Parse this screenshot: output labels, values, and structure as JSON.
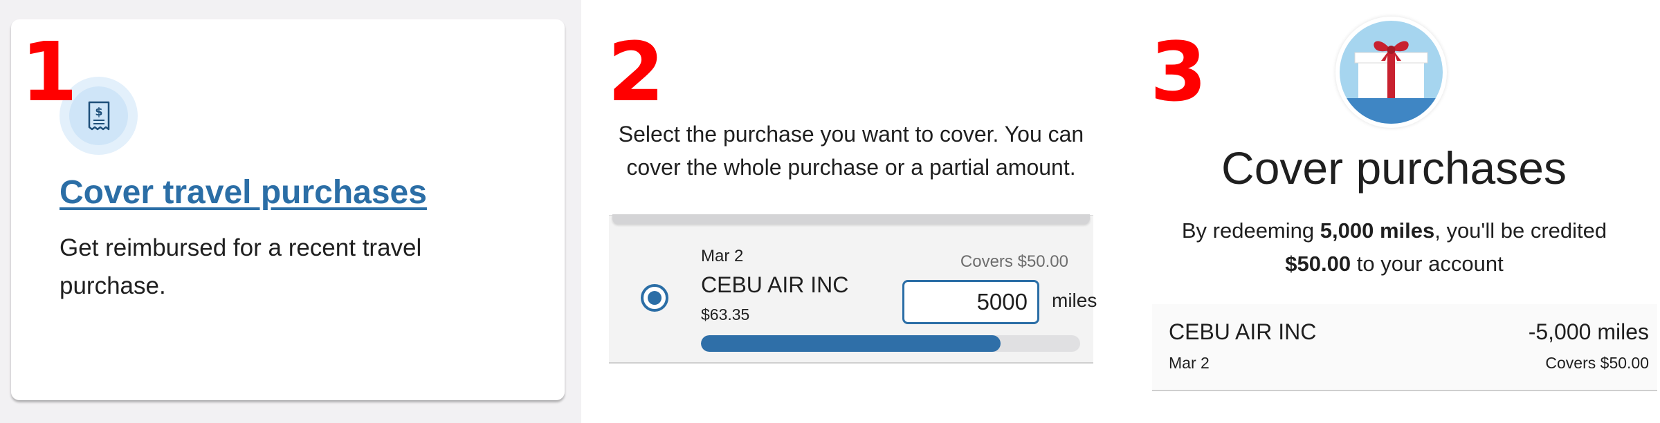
{
  "steps": {
    "one": "1",
    "two": "2",
    "three": "3"
  },
  "panel1": {
    "link_label": "Cover travel purchases",
    "description": "Get reimbursed for a recent travel purchase.",
    "icon": "receipt-dollar-icon"
  },
  "panel2": {
    "instructions": "Select the purchase you want to cover. You can cover the whole purchase or a partial amount.",
    "purchase": {
      "date": "Mar 2",
      "merchant": "CEBU AIR INC",
      "amount": "$63.35",
      "covers": "Covers $50.00",
      "miles_value": "5000",
      "miles_unit": "miles",
      "selected": true,
      "progress_fraction": 0.79
    }
  },
  "panel3": {
    "icon": "gift-box-icon",
    "title": "Cover purchases",
    "message": {
      "prefix": "By redeeming ",
      "miles": "5,000 miles",
      "middle": ", you'll be credited ",
      "credit": "$50.00",
      "suffix": " to your account"
    },
    "summary": {
      "merchant": "CEBU AIR INC",
      "miles": "-5,000 miles",
      "date": "Mar 2",
      "covers": "Covers $50.00"
    }
  },
  "colors": {
    "step_number": "#ff0000",
    "link": "#2b6ea6",
    "accent": "#2f6fa8",
    "gift_sky": "#a6d5ef",
    "gift_ribbon": "#c8212f"
  }
}
